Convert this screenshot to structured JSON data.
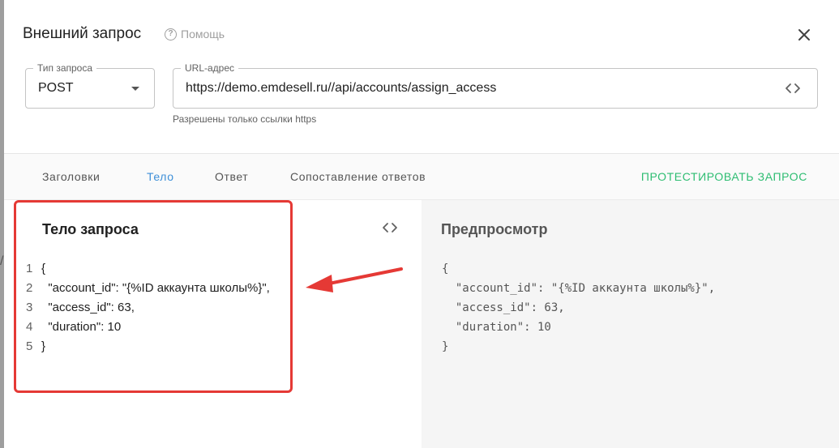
{
  "dialog": {
    "title": "Внешний запрос",
    "help_label": "Помощь",
    "help_icon": "question-circle-icon",
    "close_icon": "close-icon"
  },
  "request": {
    "method_label": "Тип запроса",
    "method_value": "POST",
    "url_label": "URL-адрес",
    "url_value": "https://demo.emdesell.ru//api/accounts/assign_access",
    "url_hint": "Разрешены только ссылки https"
  },
  "tabs": [
    {
      "label": "Заголовки",
      "active": false
    },
    {
      "label": "Тело",
      "active": true
    },
    {
      "label": "Ответ",
      "active": false
    },
    {
      "label": "Сопоставление ответов",
      "active": false
    }
  ],
  "test_button": "ПРОТЕСТИРОВАТЬ ЗАПРОС",
  "editor": {
    "title": "Тело запроса",
    "lines": [
      {
        "no": "1",
        "text": "{"
      },
      {
        "no": "2",
        "text": "  \"account_id\": \"{%ID аккаунта школы%}\","
      },
      {
        "no": "3",
        "text": "  \"access_id\": 63,"
      },
      {
        "no": "4",
        "text": "  \"duration\": 10"
      },
      {
        "no": "5",
        "text": "}"
      }
    ]
  },
  "preview": {
    "title": "Предпросмотр",
    "lines": [
      "{",
      "  \"account_id\": \"{%ID аккаунта школы%}\",",
      "  \"access_id\": 63,",
      "  \"duration\": 10",
      "}"
    ]
  },
  "colors": {
    "accent_tab": "#3d8fd8",
    "test_button": "#2ebd72",
    "annotation": "#e53935"
  }
}
